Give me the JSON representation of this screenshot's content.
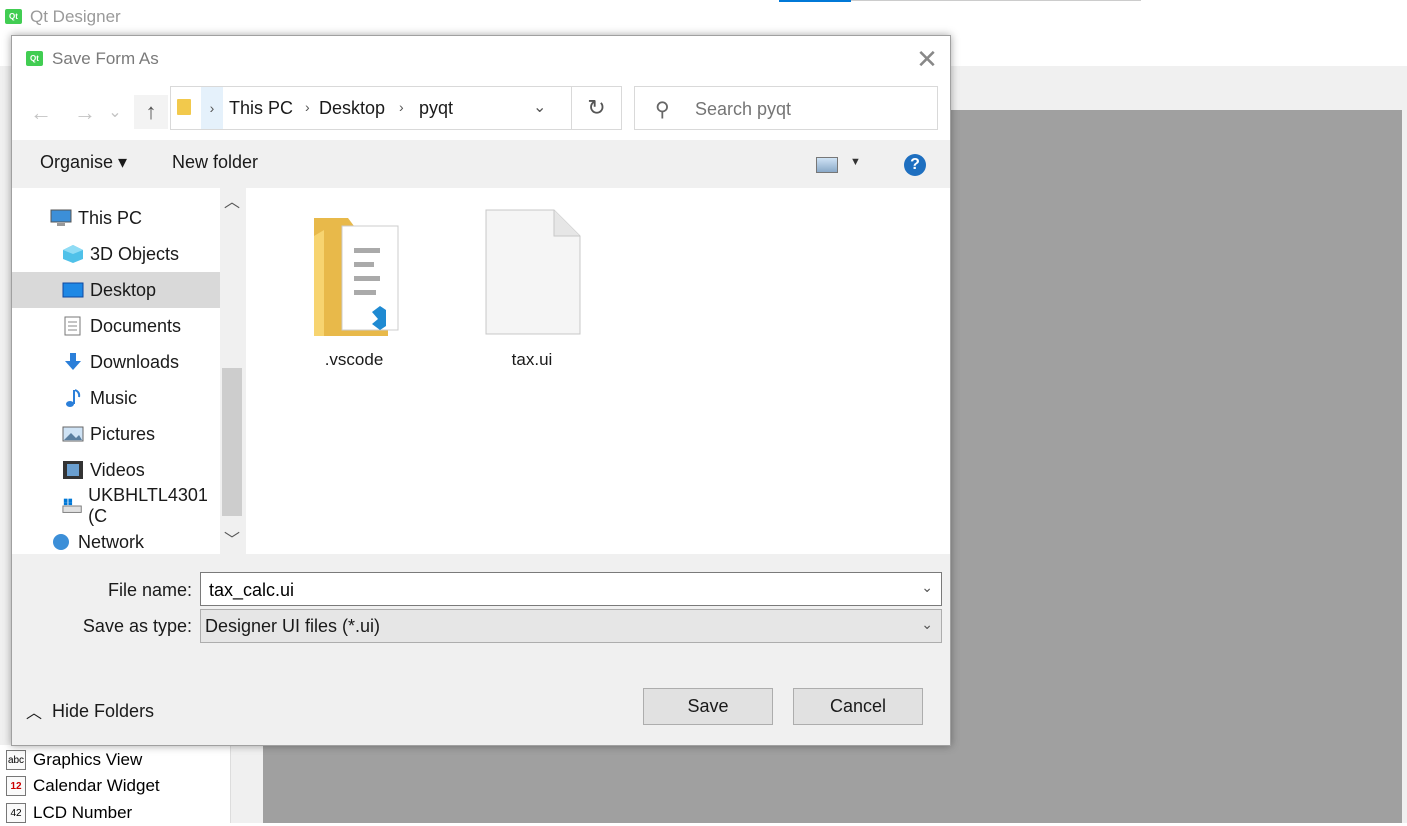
{
  "app": {
    "title": "Qt Designer",
    "logo_text": "Qt"
  },
  "widget_box": {
    "items": [
      {
        "label": "Graphics View",
        "icon": "graphics-view-icon",
        "glyph": "abc"
      },
      {
        "label": "Calendar Widget",
        "icon": "calendar-icon",
        "glyph": "12"
      },
      {
        "label": "LCD Number",
        "icon": "lcd-number-icon",
        "glyph": "42"
      }
    ]
  },
  "dialog": {
    "title": "Save Form As",
    "close_glyph": "✕",
    "nav": {
      "back_glyph": "←",
      "forward_glyph": "→",
      "recent_glyph": "⌄",
      "up_glyph": "↑"
    },
    "address": {
      "crumbs": [
        "This PC",
        "Desktop",
        "pyqt"
      ],
      "separator": "›"
    },
    "refresh_glyph": "↻",
    "search": {
      "placeholder": "Search pyqt"
    },
    "commands": {
      "organise": "Organise ▾",
      "new_folder": "New folder",
      "help_glyph": "?"
    },
    "tree": {
      "items": [
        {
          "label": "This PC",
          "icon": "this-pc-icon",
          "level": 0,
          "selected": false
        },
        {
          "label": "3D Objects",
          "icon": "3d-objects-icon",
          "level": 1,
          "selected": false
        },
        {
          "label": "Desktop",
          "icon": "desktop-icon",
          "level": 1,
          "selected": true
        },
        {
          "label": "Documents",
          "icon": "documents-icon",
          "level": 1,
          "selected": false
        },
        {
          "label": "Downloads",
          "icon": "downloads-icon",
          "level": 1,
          "selected": false
        },
        {
          "label": "Music",
          "icon": "music-icon",
          "level": 1,
          "selected": false
        },
        {
          "label": "Pictures",
          "icon": "pictures-icon",
          "level": 1,
          "selected": false
        },
        {
          "label": "Videos",
          "icon": "videos-icon",
          "level": 1,
          "selected": false
        },
        {
          "label": "UKBHLTL4301 (C",
          "icon": "drive-icon",
          "level": 1,
          "selected": false
        },
        {
          "label": "Network",
          "icon": "network-icon",
          "level": 0,
          "selected": false
        }
      ]
    },
    "files": [
      {
        "name": ".vscode",
        "type": "folder"
      },
      {
        "name": "tax.ui",
        "type": "file"
      }
    ],
    "file_name": {
      "label": "File name:",
      "value": "tax_calc.ui"
    },
    "save_as_type": {
      "label": "Save as type:",
      "value": "Designer UI files (*.ui)"
    },
    "hide_folders": "Hide Folders",
    "save_button": "Save",
    "cancel_button": "Cancel"
  },
  "colors": {
    "accent": "#0078d7",
    "selection": "#d9d9d9",
    "workspace": "#a0a0a0",
    "qt_green": "#41cd52"
  }
}
